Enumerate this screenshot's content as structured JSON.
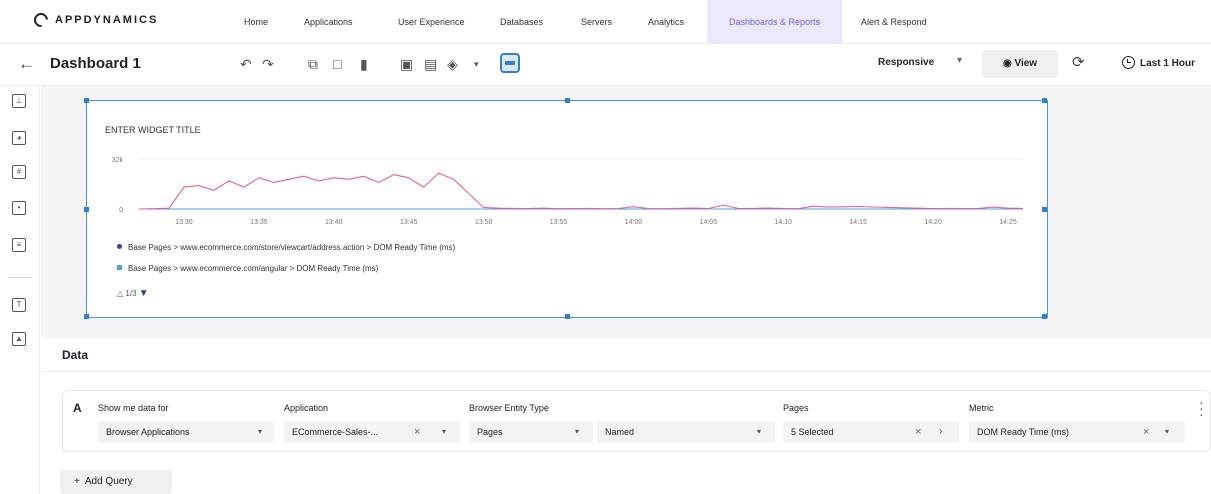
{
  "brand": {
    "name": "APPDYNAMICS"
  },
  "nav": {
    "items": [
      {
        "label": "Home"
      },
      {
        "label": "Applications"
      },
      {
        "label": "User Experience"
      },
      {
        "label": "Databases"
      },
      {
        "label": "Servers"
      },
      {
        "label": "Analytics"
      },
      {
        "label": "Dashboards & Reports",
        "active": true
      },
      {
        "label": "Alert & Respond"
      }
    ]
  },
  "toolbar": {
    "title": "Dashboard 1",
    "responsive_label": "Responsive",
    "view_label": "View",
    "time_range": "Last 1 Hour",
    "accent": "#2f7ed8"
  },
  "widget": {
    "title": "ENTER WIDGET TITLE",
    "legend": [
      {
        "label": "Base Pages > www.ecommerce.com/store/viewcart/address.action > DOM Ready Time (ms)",
        "color": "#4b3a8f"
      },
      {
        "label": "Base Pages > www.ecommerce.com/angular > DOM Ready Time (ms)",
        "color": "#4aa3df"
      }
    ],
    "pager": "1/3"
  },
  "chart_data": {
    "type": "line",
    "y_ticks": [
      "32k",
      "0"
    ],
    "x_ticks": [
      "13:30",
      "13:35",
      "13:40",
      "13:45",
      "13:50",
      "13:55",
      "14:00",
      "14:05",
      "14:10",
      "14:15",
      "14:20",
      "14:25"
    ],
    "ylim": [
      0,
      32000
    ],
    "series": [
      {
        "color": "#e8609a",
        "x": [
          0,
          1,
          2,
          3,
          4,
          5,
          6,
          7,
          8,
          9,
          10,
          11,
          12,
          13,
          14,
          15,
          16,
          17,
          18,
          19,
          20,
          21,
          22,
          23,
          24,
          25,
          26,
          27,
          28,
          29,
          30,
          31,
          32,
          33,
          34,
          35,
          36,
          37,
          38,
          39,
          40,
          41,
          42,
          43,
          44,
          45,
          46,
          47,
          48,
          49,
          50,
          51,
          52,
          53,
          54,
          55,
          56,
          57,
          58,
          59
        ],
        "y": [
          0,
          200,
          500,
          14000,
          15000,
          12000,
          18000,
          14000,
          20000,
          17000,
          19000,
          21000,
          18000,
          20000,
          19000,
          21000,
          17000,
          22000,
          20000,
          14000,
          23000,
          19000,
          10000,
          1000,
          500,
          400,
          300,
          500,
          200,
          300,
          400,
          200,
          300,
          1500,
          300,
          200,
          400,
          600,
          300,
          2500,
          300,
          400,
          600,
          300,
          200,
          1800,
          1200,
          1400,
          1600,
          1300,
          1000,
          800,
          500,
          300,
          400,
          300,
          400,
          1200,
          500,
          400
        ]
      },
      {
        "color": "#4aa3df",
        "x": [
          0,
          59
        ],
        "y": [
          0,
          0
        ]
      }
    ]
  },
  "data_section": {
    "title": "Data",
    "query": {
      "letter": "A",
      "fields": [
        {
          "label": "Show me data for",
          "value": "Browser Applications"
        },
        {
          "label": "Application",
          "value": "ECommerce-Sales-..."
        },
        {
          "label": "Browser Entity Type",
          "value": "Pages"
        },
        {
          "label": "",
          "value": "Named"
        },
        {
          "label": "Pages",
          "value": "5 Selected"
        },
        {
          "label": "Metric",
          "value": "DOM Ready Time (ms)"
        }
      ]
    },
    "add_query_label": "Add Query"
  }
}
